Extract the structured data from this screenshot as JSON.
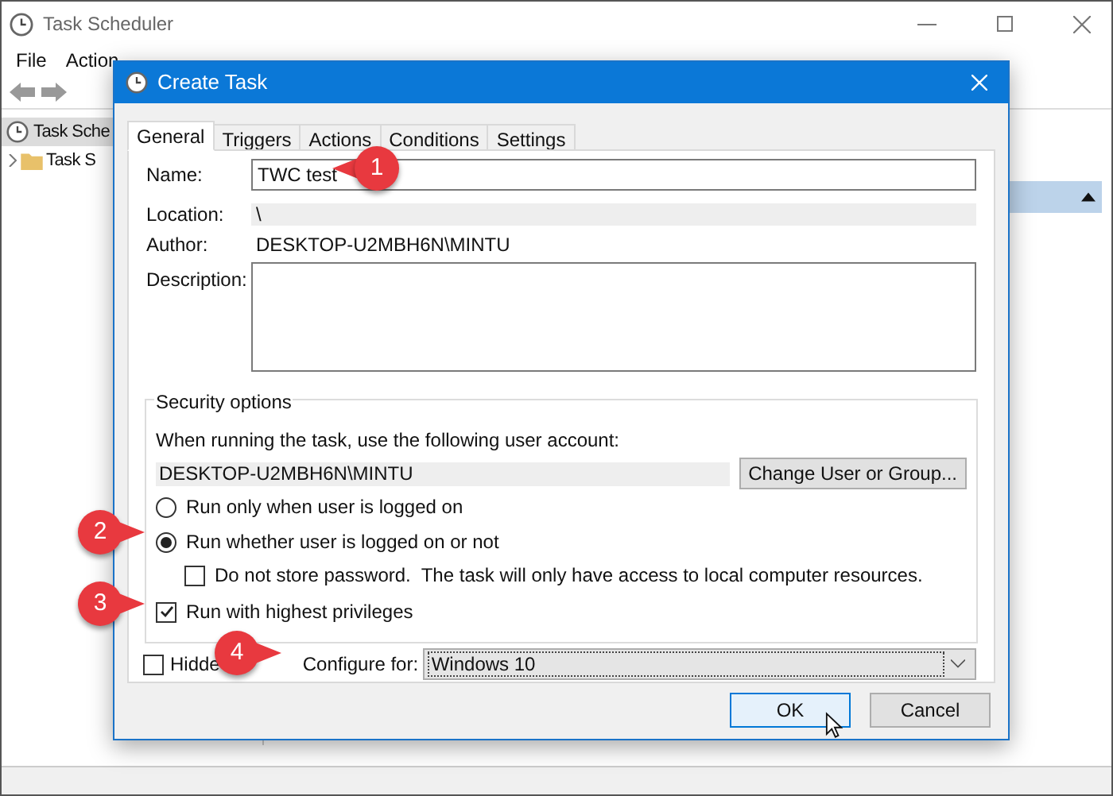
{
  "window": {
    "title": "Task Scheduler"
  },
  "menu": [
    "File",
    "Action"
  ],
  "tree": [
    {
      "label": "Task Sche",
      "expanded": true,
      "children": [
        {
          "label": "Task S",
          "expanded": false
        }
      ]
    }
  ],
  "dialog": {
    "title": "Create Task",
    "tabs": [
      {
        "label": "General",
        "selected": true
      },
      {
        "label": "Triggers",
        "selected": false
      },
      {
        "label": "Actions",
        "selected": false
      },
      {
        "label": "Conditions",
        "selected": false
      },
      {
        "label": "Settings",
        "selected": false
      }
    ],
    "name": {
      "label": "Name:",
      "value": "TWC test"
    },
    "location": {
      "label": "Location:",
      "value": "\\"
    },
    "author": {
      "label": "Author:",
      "value": "DESKTOP-U2MBH6N\\MINTU"
    },
    "description": {
      "label": "Description:"
    },
    "security": {
      "title": "Security options",
      "prompt": "When running the task, use the following user account:",
      "account": "DESKTOP-U2MBH6N\\MINTU",
      "change_button": "Change User or Group...",
      "radios": [
        {
          "label": "Run only when user is logged on",
          "selected": false
        },
        {
          "label": "Run whether user is logged on or not",
          "selected": true
        }
      ],
      "no_password": {
        "label": "Do not store password.  The task will only have access to local computer resources.",
        "checked": false
      },
      "highest": {
        "label": "Run with highest privileges",
        "checked": true
      }
    },
    "hidden": {
      "label": "Hidde",
      "checked": false
    },
    "configure": {
      "label": "Configure for:",
      "value": "Windows 10"
    },
    "buttons": [
      {
        "label": "OK",
        "default": true
      },
      {
        "label": "Cancel",
        "default": false
      }
    ]
  },
  "callouts": [
    "1",
    "2",
    "3",
    "4"
  ]
}
